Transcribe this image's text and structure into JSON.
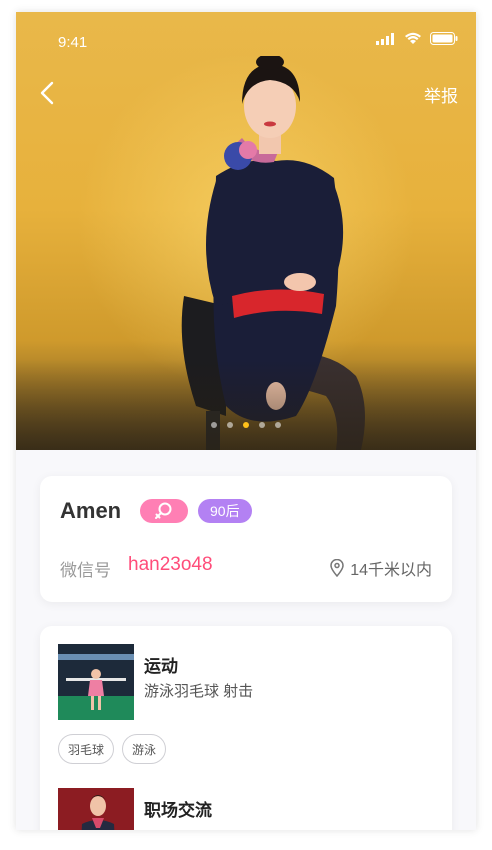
{
  "status_bar": {
    "time": "9:41"
  },
  "nav": {
    "report_label": "举报"
  },
  "carousel": {
    "count": 5,
    "active_index": 2
  },
  "profile": {
    "name": "Amen",
    "age_badge": "90后",
    "wechat_label": "微信号",
    "wechat_id": "han23o48",
    "distance": "14千米以内"
  },
  "interests": [
    {
      "title": "运动",
      "desc": "游泳羽毛球 射击",
      "tags": [
        "羽毛球",
        "游泳"
      ]
    },
    {
      "title": "职场交流"
    }
  ],
  "colors": {
    "gender_badge": "#ff7fb4",
    "age_badge": "#b381f3",
    "wechat_id": "#ff4d7a",
    "carousel_active_dot": "#ffc11a"
  }
}
